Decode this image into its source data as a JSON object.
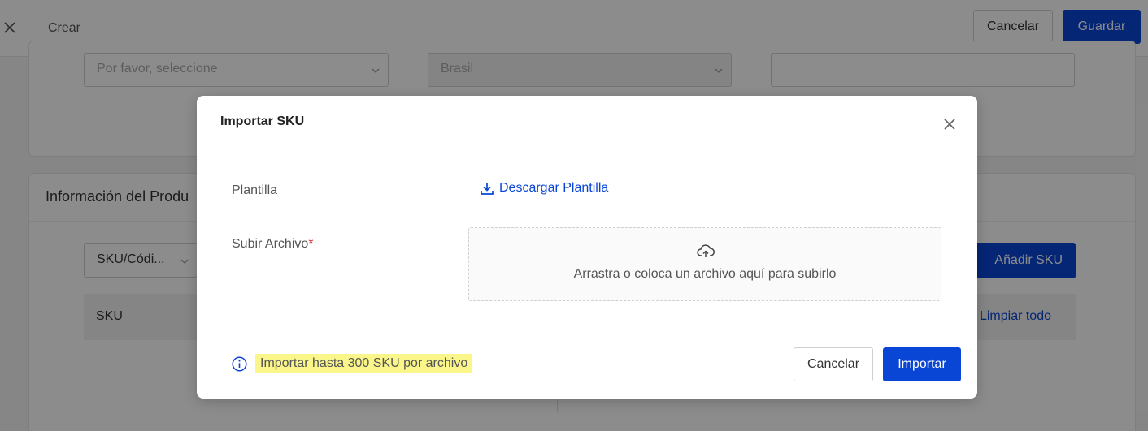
{
  "topbar": {
    "title": "Crear",
    "cancel_label": "Cancelar",
    "save_label": "Guardar"
  },
  "background": {
    "select1_placeholder": "Por favor, seleccione",
    "select2_value": "Brasil",
    "section_title": "Información del Produ",
    "filter_value": "SKU/Códi...",
    "add_sku_label": "Añadir SKU",
    "table_sku_header": "SKU",
    "clear_all_label": "Limpiar todo"
  },
  "modal": {
    "title": "Importar SKU",
    "template_label": "Plantilla",
    "download_label": "Descargar Plantilla",
    "upload_label": "Subir Archivo",
    "required_mark": "*",
    "dropzone_text": "Arrastra o coloca un archivo aquí para subirlo",
    "info_text": "Importar hasta 300 SKU por archivo",
    "cancel_label": "Cancelar",
    "import_label": "Importar"
  },
  "colors": {
    "primary": "#0a46d6",
    "highlight": "#fbf68a",
    "required": "#d9363e"
  },
  "icons": {
    "close": "close-icon",
    "download": "download-icon",
    "upload": "upload-cloud-icon",
    "info": "info-icon",
    "chevron": "chevron-down-icon"
  }
}
